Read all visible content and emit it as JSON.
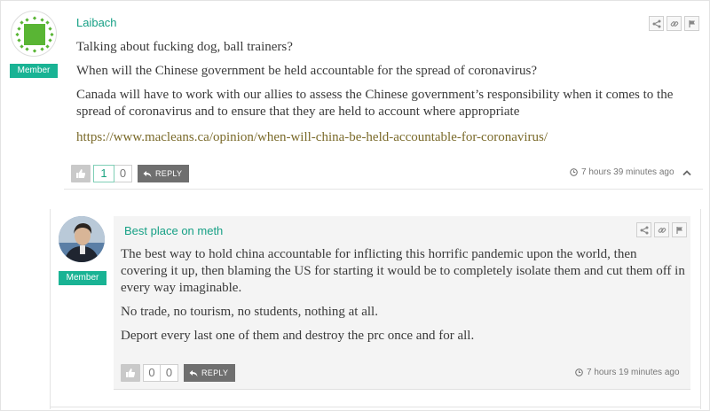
{
  "comments": [
    {
      "author": "Laibach",
      "badge": "Member",
      "paragraphs": [
        "Talking about fucking dog, ball trainers?",
        "When will the Chinese government be held accountable for the spread of coronavirus?",
        "Canada will have to work with our allies to assess the Chinese government’s responsibility when it comes to the spread of coronavirus and to ensure that they are held to account where appropriate"
      ],
      "link": "https://www.macleans.ca/opinion/when-will-china-be-held-accountable-for-coronavirus/",
      "upvotes": "1",
      "downvotes": "0",
      "reply_label": "REPLY",
      "time": "7 hours 39 minutes ago",
      "avatar_color": "#59b534"
    },
    {
      "author": "Best place on meth",
      "badge": "Member",
      "paragraphs": [
        "The best way to hold china accountable for inflicting this horrific pandemic upon the world, then covering it up, then blaming the US for starting it would be to completely isolate them and cut them off in every way imaginable.",
        "No trade, no tourism, no students, nothing at all.",
        "Deport every last one of them and destroy the prc once and for all."
      ],
      "upvotes": "0",
      "downvotes": "0",
      "reply_label": "REPLY",
      "time": "7 hours 19 minutes ago"
    }
  ],
  "icons": {
    "share": "share-icon",
    "link": "link-icon",
    "flag": "flag-icon",
    "thumb": "thumbs-up-icon",
    "reply": "reply-arrow-icon",
    "clock": "clock-icon",
    "collapse": "chevron-up-icon"
  },
  "colors": {
    "accent": "#19b394",
    "author": "#16a085",
    "button": "#6f6f6f"
  }
}
